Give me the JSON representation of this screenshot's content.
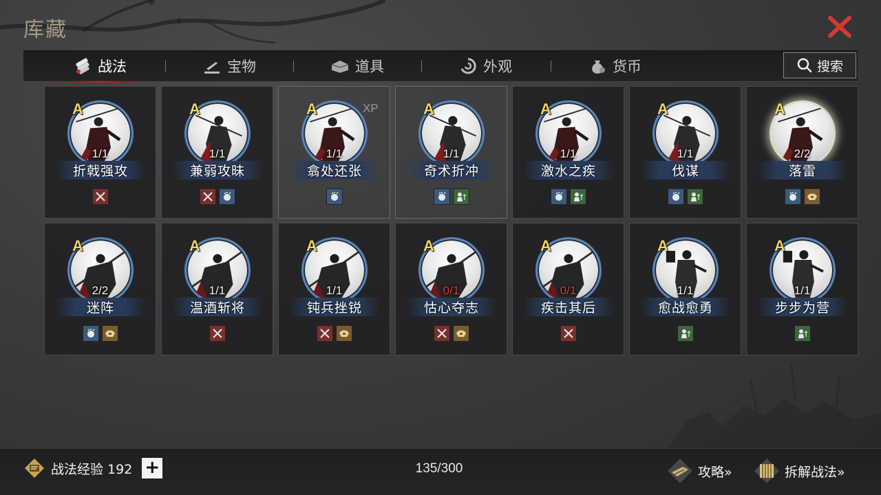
{
  "title": "库藏",
  "tabs": [
    {
      "label": "战法",
      "icon": "scroll-bundle-icon",
      "active": true
    },
    {
      "label": "宝物",
      "icon": "anvil-icon",
      "active": false
    },
    {
      "label": "道具",
      "icon": "chest-icon",
      "active": false
    },
    {
      "label": "外观",
      "icon": "swirl-icon",
      "active": false
    },
    {
      "label": "货币",
      "icon": "money-bag-icon",
      "active": false
    }
  ],
  "search_label": "搜索",
  "cards": [
    {
      "grade": "A",
      "count": "1/1",
      "name": "折戟强攻",
      "tags": [
        "red"
      ],
      "xp": ""
    },
    {
      "grade": "A",
      "count": "1/1",
      "name": "兼弱攻昧",
      "tags": [
        "red",
        "blue"
      ],
      "xp": ""
    },
    {
      "grade": "A",
      "count": "1/1",
      "name": "翕处还张",
      "tags": [
        "blue"
      ],
      "xp": "XP"
    },
    {
      "grade": "A",
      "count": "1/1",
      "name": "奇术折冲",
      "tags": [
        "blue",
        "green"
      ],
      "xp": ""
    },
    {
      "grade": "A",
      "count": "1/1",
      "name": "激水之疾",
      "tags": [
        "blue",
        "green"
      ],
      "xp": ""
    },
    {
      "grade": "A",
      "count": "1/1",
      "name": "伐谋",
      "tags": [
        "blue",
        "green"
      ],
      "xp": ""
    },
    {
      "grade": "A",
      "count": "2/2",
      "name": "落雷",
      "tags": [
        "blue",
        "gold"
      ],
      "xp": ""
    },
    {
      "grade": "A",
      "count": "2/2",
      "name": "迷阵",
      "tags": [
        "blue",
        "gold"
      ],
      "xp": ""
    },
    {
      "grade": "A",
      "count": "1/1",
      "name": "温酒斩将",
      "tags": [
        "red"
      ],
      "xp": ""
    },
    {
      "grade": "A",
      "count": "1/1",
      "name": "钝兵挫锐",
      "tags": [
        "red",
        "gold"
      ],
      "xp": ""
    },
    {
      "grade": "A",
      "count": "0/1",
      "name": "怙心夺志",
      "tags": [
        "red",
        "gold"
      ],
      "xp": ""
    },
    {
      "grade": "A",
      "count": "0/1",
      "name": "疾击其后",
      "tags": [
        "red"
      ],
      "xp": ""
    },
    {
      "grade": "A",
      "count": "1/1",
      "name": "愈战愈勇",
      "tags": [
        "green"
      ],
      "xp": ""
    },
    {
      "grade": "A",
      "count": "1/1",
      "name": "步步为营",
      "tags": [
        "green"
      ],
      "xp": ""
    }
  ],
  "footer": {
    "exp_label": "战法经验 192",
    "plus": "+",
    "capacity": "135/300",
    "guide_label": "攻略»",
    "decompose_label": "拆解战法»"
  },
  "colors": {
    "accent_red": "#d4433b",
    "grade_gold": "#f3d163",
    "ring_blue": "#5a86b8"
  }
}
